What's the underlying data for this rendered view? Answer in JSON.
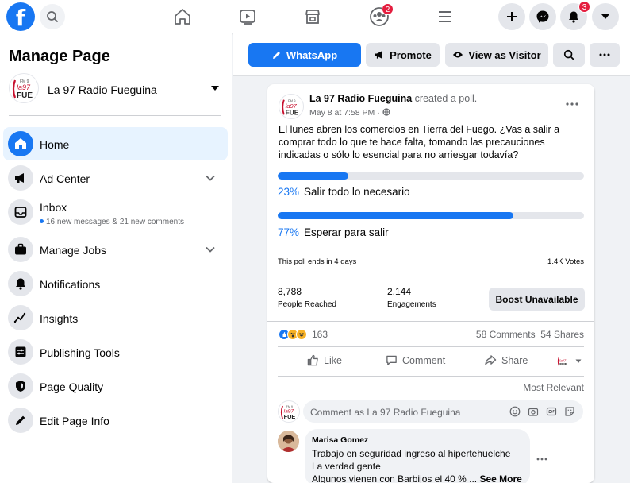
{
  "topbar": {
    "logo": "f",
    "nav_icons": [
      "home-icon",
      "watch-icon",
      "marketplace-icon",
      "groups-icon",
      "menu-icon"
    ],
    "groups_badge": "2",
    "notifications_badge": "3"
  },
  "sidebar": {
    "title": "Manage Page",
    "page_name": "La 97 Radio Fueguina",
    "logo_small": "FM 9",
    "logo_mid": "la97",
    "logo_big": "FUE",
    "items": [
      {
        "label": "Home",
        "icon": "home-icon"
      },
      {
        "label": "Ad Center",
        "icon": "megaphone-icon"
      },
      {
        "label": "Inbox",
        "icon": "inbox-icon",
        "sub": "16 new messages & 21 new comments"
      },
      {
        "label": "Manage Jobs",
        "icon": "briefcase-icon"
      },
      {
        "label": "Notifications",
        "icon": "bell-icon"
      },
      {
        "label": "Insights",
        "icon": "insights-icon"
      },
      {
        "label": "Publishing Tools",
        "icon": "publishing-tools-icon"
      },
      {
        "label": "Page Quality",
        "icon": "shield-icon"
      },
      {
        "label": "Edit Page Info",
        "icon": "pencil-icon"
      }
    ]
  },
  "actionbar": {
    "whatsapp": "WhatsApp",
    "promote": "Promote",
    "view_as_visitor": "View as Visitor"
  },
  "post": {
    "author": "La 97 Radio Fueguina",
    "action": "created a poll.",
    "meta": "May 8 at 7:58 PM ·",
    "text": "El lunes abren los comercios en Tierra del Fuego. ¿Vas a salir a comprar todo lo que te hace falta, tomando las precauciones indicadas o sólo lo esencial para no arriesgar todavía?",
    "poll": {
      "options": [
        {
          "pct": "23%",
          "label": "Salir todo lo necesario",
          "value": 23
        },
        {
          "pct": "77%",
          "label": "Esperar para salir",
          "value": 77
        }
      ],
      "ends": "This poll ends in 4 days",
      "votes": "1.4K Votes"
    },
    "stats": {
      "reached_num": "8,788",
      "reached_label": "People Reached",
      "eng_num": "2,144",
      "eng_label": "Engagements",
      "boost": "Boost Unavailable"
    },
    "reactions_count": "163",
    "comments": "58 Comments",
    "shares": "54 Shares",
    "actions": {
      "like": "Like",
      "comment": "Comment",
      "share": "Share"
    },
    "sort": "Most Relevant",
    "comment_placeholder": "Comment as La 97 Radio Fueguina"
  },
  "comment": {
    "name": "Marisa Gomez",
    "line1": "Trabajo en seguridad ingreso al hipertehuelche",
    "line2": "La verdad gente",
    "line3": "Algunos vienen con Barbijos el 40 % ...",
    "see_more": "See More"
  },
  "colors": {
    "brand": "#1877f2",
    "badge": "#e41e3f"
  }
}
